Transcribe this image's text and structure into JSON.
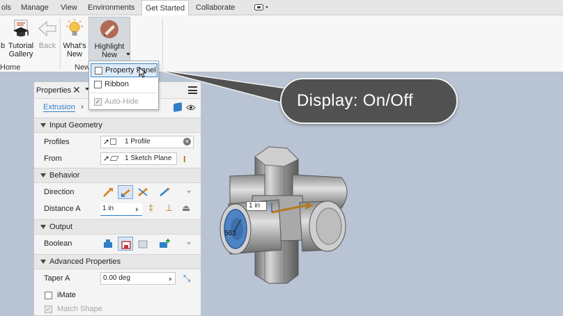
{
  "menu_tabs": [
    "ols",
    "Manage",
    "View",
    "Environments",
    "Get Started",
    "Collaborate"
  ],
  "active_tab": "Get Started",
  "ribbon": {
    "web_label_fragment": "b",
    "tutorial_gallery": "Tutorial\nGallery",
    "back": "Back",
    "whats_new": "What's\nNew",
    "highlight_new": "Highlight\nNew",
    "group_home_fragment": "Home",
    "group_new_fragment": "New"
  },
  "dropdown": {
    "items": [
      {
        "label": "Property Panel",
        "checked": false,
        "highlighted": true
      },
      {
        "label": "Ribbon",
        "checked": false
      },
      {
        "label": "Auto-Hide",
        "checked": true,
        "disabled": true
      }
    ]
  },
  "callout": {
    "text": "Display: On/Off"
  },
  "properties": {
    "title": "Properties",
    "feature": "Extrusion",
    "sections": {
      "input_geometry": "Input Geometry",
      "behavior": "Behavior",
      "output": "Output",
      "advanced": "Advanced Properties"
    },
    "profiles_label": "Profiles",
    "profiles_value": "1 Profile",
    "from_label": "From",
    "from_value": "1 Sketch Plane",
    "direction_label": "Direction",
    "distance_label": "Distance A",
    "distance_value": "1 in",
    "boolean_label": "Boolean",
    "taper_label": "Taper A",
    "taper_value": "0.00 deg",
    "imate_label": "iMate",
    "match_shape_label": "Match Shape"
  },
  "canvas": {
    "dimension_value": "1 in",
    "face_label": "563"
  },
  "colors": {
    "accent": "#2f7fc6",
    "callout_bg": "#515151",
    "viewport_bg": "#b8c4d4"
  }
}
